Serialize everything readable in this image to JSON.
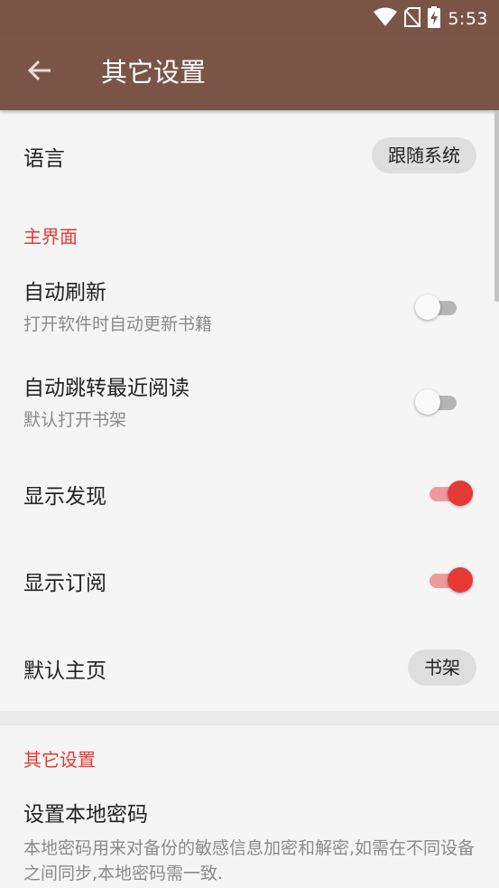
{
  "status_bar": {
    "time": "5:53",
    "icons": [
      "wifi-icon",
      "no-sim-icon",
      "battery-charging-icon"
    ]
  },
  "app_bar": {
    "back_icon": "arrow-left-icon",
    "title": "其它设置"
  },
  "colors": {
    "primary": "#7a5547",
    "accent": "#e53935",
    "background": "#f5f5f5"
  },
  "settings": {
    "language": {
      "title": "语言",
      "value": "跟随系统"
    },
    "main_section": {
      "header": "主界面",
      "auto_refresh": {
        "title": "自动刷新",
        "summary": "打开软件时自动更新书籍",
        "enabled": false
      },
      "auto_jump": {
        "title": "自动跳转最近阅读",
        "summary": "默认打开书架",
        "enabled": false
      },
      "show_discovery": {
        "title": "显示发现",
        "enabled": true
      },
      "show_rss": {
        "title": "显示订阅",
        "enabled": true
      },
      "default_home": {
        "title": "默认主页",
        "value": "书架"
      }
    },
    "other_section": {
      "header": "其它设置",
      "local_password": {
        "title": "设置本地密码",
        "summary": "本地密码用来对备份的敏感信息加密和解密,如需在不同设备之间同步,本地密码需一致."
      }
    }
  }
}
